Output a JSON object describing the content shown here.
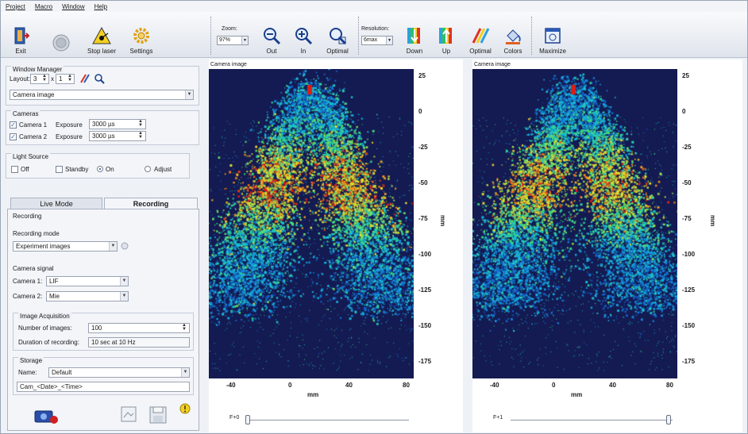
{
  "menu": [
    "Project",
    "Macro",
    "Window",
    "Help"
  ],
  "toolbar": {
    "exit": "Exit",
    "stop_laser": "Stop laser",
    "settings": "Settings",
    "zoom_label": "Zoom:",
    "zoom_value": "97%",
    "zoom_out": "Out",
    "zoom_in": "In",
    "optimal": "Optimal",
    "resolution_label": "Resolution:",
    "resolution_value": "6max",
    "down": "Down",
    "up": "Up",
    "optimal2": "Optimal",
    "colors": "Colors",
    "maximize": "Maximize"
  },
  "window_manager": {
    "title": "Window Manager",
    "layout_label": "Layout:",
    "layout_x": "3",
    "layout_times": "x",
    "layout_y": "1",
    "view_select": "Camera image"
  },
  "cameras": {
    "title": "Cameras",
    "cam1_label": "Camera 1",
    "cam2_label": "Camera 2",
    "exposure_label": "Exposure",
    "cam1_exposure": "3000 µs",
    "cam2_exposure": "3000 µs"
  },
  "light_source": {
    "title": "Light Source",
    "off": "Off",
    "standby": "Standby",
    "on": "On",
    "adjust": "Adjust"
  },
  "tabs": {
    "live_mode": "Live Mode",
    "recording": "Recording"
  },
  "recording": {
    "title": "Recording",
    "mode_label": "Recording mode",
    "mode_value": "Experiment images",
    "signal_label": "Camera signal",
    "cam1_label": "Camera 1:",
    "cam1_value": "LIF",
    "cam2_label": "Camera 2:",
    "cam2_value": "Mie",
    "acq_title": "Image Acquisition",
    "num_images_label": "Number of images:",
    "num_images_value": "100",
    "duration_label": "Duration of recording:",
    "duration_value": "10 sec at 10 Hz",
    "storage_title": "Storage",
    "name_label": "Name:",
    "name_value": "Default",
    "pattern_value": "Cam_<Date>_<Time>"
  },
  "views": [
    {
      "title": "Camera image",
      "frame_label": "F+0",
      "y_ticks": [
        "25",
        "0",
        "-25",
        "-50",
        "-75",
        "-100",
        "-125",
        "-150",
        "-175"
      ],
      "y_unit": "mm",
      "x_ticks": [
        "-40",
        "0",
        "40",
        "80"
      ],
      "x_unit": "mm",
      "slider_fraction": 0.0
    },
    {
      "title": "Camera image",
      "frame_label": "F+1",
      "y_ticks": [
        "25",
        "0",
        "-25",
        "-50",
        "-75",
        "-100",
        "-125",
        "-150",
        "-175"
      ],
      "y_unit": "mm",
      "x_ticks": [
        "-40",
        "0",
        "40",
        "80"
      ],
      "x_unit": "mm",
      "slider_fraction": 1.0
    }
  ],
  "colors": {
    "image_background": "#141a52",
    "accent_blue": "#2a5ab8"
  }
}
